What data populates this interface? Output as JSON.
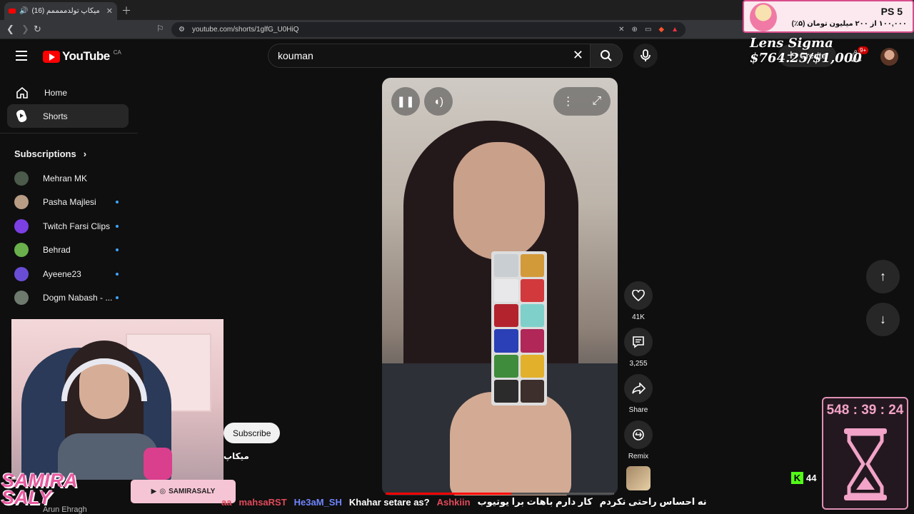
{
  "browser": {
    "tab_title": "(16) میکاپ تولدممممم",
    "url": "youtube.com/shorts/1glfG_U0HiQ"
  },
  "header": {
    "logo_text": "YouTube",
    "country_code": "CA",
    "search_value": "kouman",
    "create_label": "Create",
    "notification_badge": "9+"
  },
  "sidebar": {
    "items": [
      {
        "label": "Home",
        "icon": "home-icon"
      },
      {
        "label": "Shorts",
        "icon": "shorts-icon",
        "active": true
      }
    ],
    "subscriptions_title": "Subscriptions",
    "subscriptions": [
      {
        "name": "Mehran MK",
        "color": "#4b5a4a",
        "new": false
      },
      {
        "name": "Pasha Majlesi",
        "color": "#b89c84",
        "new": true
      },
      {
        "name": "Twitch Farsi Clips",
        "color": "#7b3fe4",
        "new": true
      },
      {
        "name": "Behrad",
        "color": "#6ab04c",
        "new": true
      },
      {
        "name": "Ayeene23",
        "color": "#6a4dd6",
        "new": true
      },
      {
        "name": "Dogm Nabash - ...",
        "color": "#6d7a6d",
        "new": true
      }
    ]
  },
  "shorts": {
    "progress": 0.55,
    "palette_colors": [
      "#c9ced3",
      "#d39a3a",
      "#e8e8ea",
      "#d1393c",
      "#b3232e",
      "#7fd0cb",
      "#2b3fb6",
      "#b02758",
      "#3f8c3d",
      "#e2b02b",
      "#2b2b2b",
      "#3d2f2c"
    ],
    "actions": [
      {
        "name": "like",
        "icon": "heart-icon",
        "label": "41K"
      },
      {
        "name": "comments",
        "icon": "comment-icon",
        "label": "3,255"
      },
      {
        "name": "share",
        "icon": "share-icon",
        "label": "Share"
      },
      {
        "name": "remix",
        "icon": "remix-icon",
        "label": "Remix"
      }
    ]
  },
  "overlay": {
    "subscribe_label": "Subscribe",
    "persian_title": "میکاپ",
    "brand_line1": "SAMIRA",
    "brand_line2": "SALY",
    "social_handle": "SAMIRASALY",
    "below_cam_text": "Arun Ehragh",
    "ps5_label": "PS 5",
    "goal_text": "۱۰۰,۰۰۰ از ۲۰۰ میلیون تومان (۵٪)",
    "lens_goal": "Lens Sigma $764.25/$1,000",
    "timer": "548 : 39 : 24",
    "kick_viewers": "44",
    "chat": [
      {
        "user": "aa",
        "class": "user-red",
        "msg": ""
      },
      {
        "user": "mahsaRST",
        "class": "user-red",
        "msg": ""
      },
      {
        "user": "He3aM_SH",
        "class": "user-blue",
        "msg": "Khahar setare as?"
      },
      {
        "user": "Ashkiin",
        "class": "user-red",
        "msg": "کار دارم باهات برا یوتیوب"
      },
      {
        "user": "",
        "class": "user-red",
        "msg": "نه احساس راحتی نکردم"
      }
    ]
  }
}
